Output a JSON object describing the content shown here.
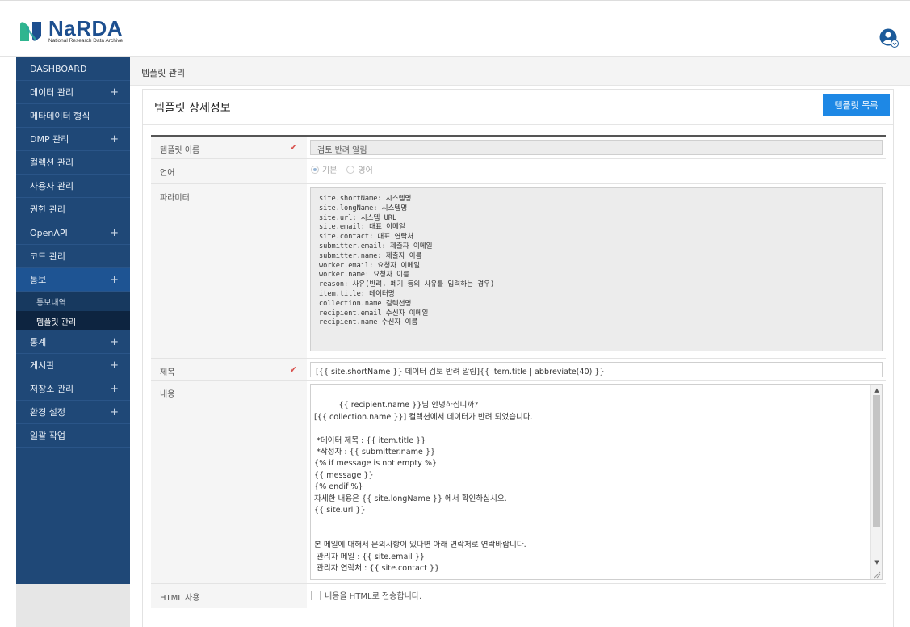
{
  "brand": {
    "name": "NaRDA",
    "subtitle": "National Research Data Archive",
    "colors": {
      "primary": "#1d4f8f",
      "green": "#2fb58f",
      "accent_button": "#1e88e5",
      "sidebar": "#1f4877"
    }
  },
  "header": {
    "user_icon": "user-avatar-icon"
  },
  "sidebar": {
    "items": [
      {
        "label": "DASHBOARD",
        "expand": ""
      },
      {
        "label": "데이터 관리",
        "expand": "+"
      },
      {
        "label": "메타데이터 형식",
        "expand": ""
      },
      {
        "label": "DMP 관리",
        "expand": "+"
      },
      {
        "label": "컬렉션 관리",
        "expand": ""
      },
      {
        "label": "사용자 관리",
        "expand": ""
      },
      {
        "label": "권한 관리",
        "expand": ""
      },
      {
        "label": "OpenAPI",
        "expand": "+"
      },
      {
        "label": "코드 관리",
        "expand": ""
      },
      {
        "label": "통보",
        "expand": "+"
      },
      {
        "label": "통계",
        "expand": "+"
      },
      {
        "label": "게시판",
        "expand": "+"
      },
      {
        "label": "저장소 관리",
        "expand": "+"
      },
      {
        "label": "환경 설정",
        "expand": "+"
      },
      {
        "label": "일괄 작업",
        "expand": ""
      }
    ],
    "subitems": [
      {
        "label": "통보내역"
      },
      {
        "label": "템플릿 관리"
      }
    ]
  },
  "breadcrumb": "템플릿 관리",
  "page": {
    "title": "템플릿 상세정보",
    "list_button": "템플릿 목록"
  },
  "form": {
    "name": {
      "label": "템플릿 이름",
      "value": "검토 반려 알림"
    },
    "language": {
      "label": "언어",
      "options": [
        "기본",
        "영어"
      ],
      "selected": "기본"
    },
    "params": {
      "label": "파라미터",
      "text": "site.shortName: 시스템명\nsite.longName: 시스템명\nsite.url: 시스템 URL\nsite.email: 대표 이메일\nsite.contact: 대표 연락처\nsubmitter.email: 제출자 이메일\nsubmitter.name: 제출자 이름\nworker.email: 요청자 이메일\nworker.name: 요청자 이름\nreason: 사유(반려, 폐기 등의 사유를 입력하는 경우)\nitem.title: 데이터명\ncollection.name 컬렉션명\nrecipient.email 수신자 이메일\nrecipient.name 수신자 이름"
    },
    "subject": {
      "label": "제목",
      "value": "[{{ site.shortName }} 데이터 검토 반려 알림]{{ item.title | abbreviate(40) }}"
    },
    "content": {
      "label": "내용",
      "text": "{{ recipient.name }}님 안녕하십니까?\n[{{ collection.name }}] 컬렉션에서 데이터가 반려 되었습니다.\n\n *데이터 제목 : {{ item.title }}\n *작성자 : {{ submitter.name }}\n{% if message is not empty %}\n{{ message }}\n{% endif %}\n자세한 내용은 {{ site.longName }} 에서 확인하십시오.\n{{ site.url }}\n\n\n본 메일에 대해서 문의사항이 있다면 아래 연락처로 연락바랍니다.\n 관리자 메일 : {{ site.email }}\n 관리자 연락처 : {{ site.contact }}"
    },
    "html": {
      "label": "HTML 사용",
      "checkbox_label": "내용을 HTML로 전송합니다.",
      "checked": false
    }
  }
}
